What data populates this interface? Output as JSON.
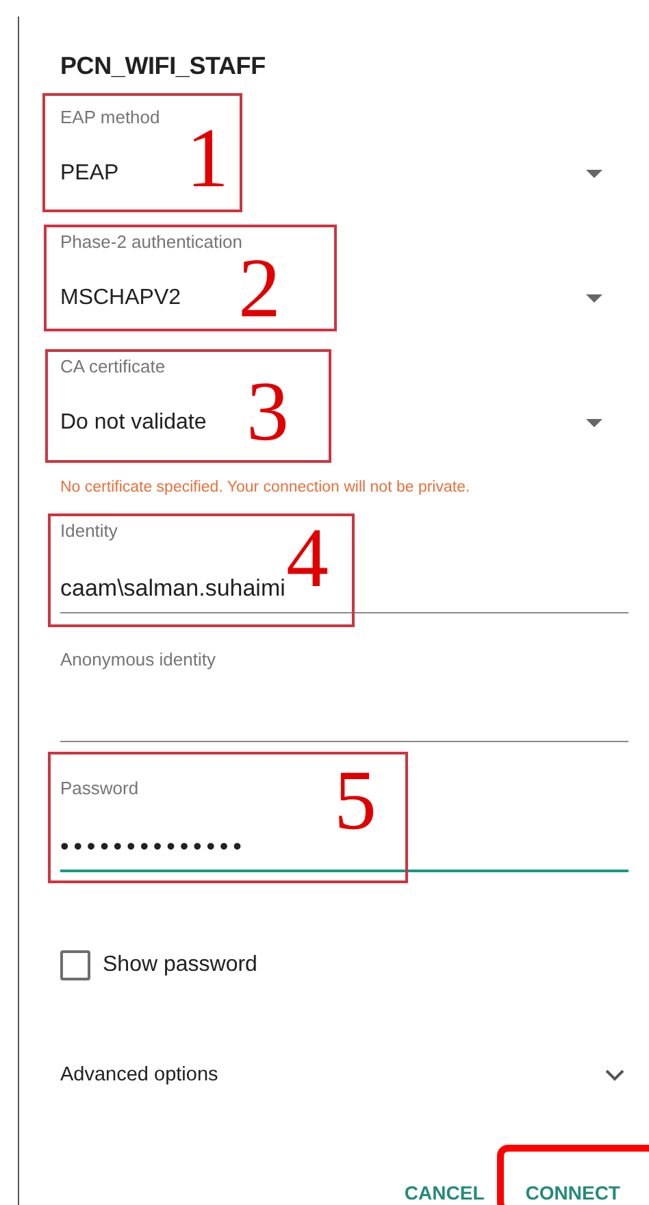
{
  "title": "PCN_WIFI_STAFF",
  "fields": [
    {
      "kind": "dropdown",
      "label": "EAP method",
      "value": "PEAP",
      "annotation": "1"
    },
    {
      "kind": "dropdown",
      "label": "Phase-2 authentication",
      "value": "MSCHAPV2",
      "annotation": "2"
    },
    {
      "kind": "dropdown",
      "label": "CA certificate",
      "value": "Do not validate",
      "annotation": "3",
      "warning": "No certificate specified. Your connection will not be private."
    },
    {
      "kind": "text",
      "label": "Identity",
      "value": "caam\\salman.suhaimi",
      "annotation": "4",
      "focused": false
    },
    {
      "kind": "text",
      "label": "Anonymous identity",
      "focused": false
    },
    {
      "kind": "password",
      "label": "Password",
      "value": "••••••••••••••",
      "annotation": "5",
      "focused": true
    }
  ],
  "show_password": {
    "label": "Show password",
    "checked": false
  },
  "advanced": {
    "label": "Advanced options",
    "expanded": false
  },
  "buttons": [
    {
      "label": "CANCEL",
      "highlighted": false
    },
    {
      "label": "CONNECT",
      "highlighted": true
    }
  ]
}
